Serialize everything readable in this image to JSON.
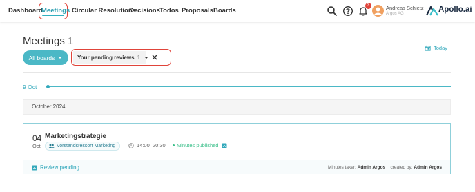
{
  "nav": {
    "items": [
      {
        "label": "Dashboard"
      },
      {
        "label": "Meetings"
      },
      {
        "label": "Circular Resolutions"
      },
      {
        "label": "Decisions"
      },
      {
        "label": "Todos"
      },
      {
        "label": "Proposals"
      },
      {
        "label": "Boards"
      }
    ],
    "active": "Meetings",
    "notification_count": "3",
    "user": {
      "name": "Andreas Schietz",
      "org": "Argos AG"
    },
    "logo_text": "Apollo.ai",
    "icons": [
      "search-icon",
      "help-icon",
      "bell-icon",
      "avatar",
      "apollo-logo-icon"
    ]
  },
  "header": {
    "title": "Meetings",
    "count": "1",
    "today_label": "Today"
  },
  "filters": {
    "boards_label": "All boards",
    "pending_label": "Your pending reviews",
    "pending_count": "1"
  },
  "timeline": {
    "date": "9 Oct",
    "month": "October 2024"
  },
  "meeting": {
    "day": "04",
    "month": "Oct",
    "title": "Marketingstrategie",
    "board": "Vorstandsressort Marketing",
    "time": "14:00–20:30",
    "status": "Minutes published",
    "review_label": "Review pending",
    "minutes_taker_label": "Minutes taker:",
    "minutes_taker": "Admin Argos",
    "created_by_label": "created by:",
    "created_by": "Admin Argos"
  },
  "colors": {
    "accent": "#4bb8c6",
    "highlight": "#e0443a",
    "success": "#3bbf8a"
  }
}
